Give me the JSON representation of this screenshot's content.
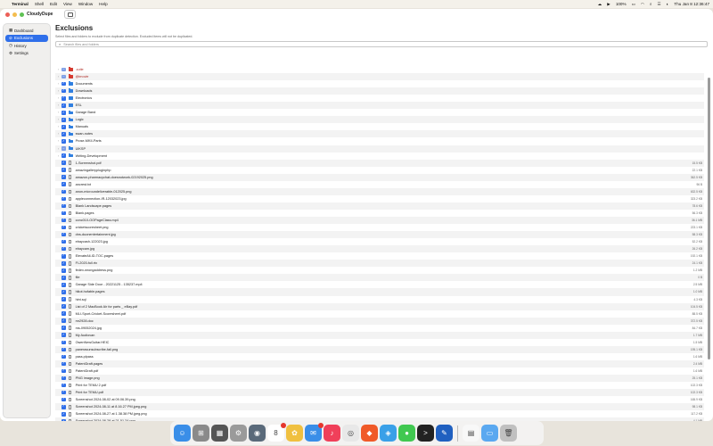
{
  "menubar": {
    "app": "Terminal",
    "menus": [
      "Shell",
      "Edit",
      "View",
      "Window",
      "Help"
    ],
    "battery": "100%",
    "datetime": "Thu Jan 8  12:36:47"
  },
  "app_title": "CloudyDupe",
  "sidebar": {
    "items": [
      {
        "label": "Dashboard",
        "icon": "dashboard-icon"
      },
      {
        "label": "Exclusions",
        "icon": "exclusions-icon"
      },
      {
        "label": "History",
        "icon": "history-icon"
      },
      {
        "label": "Settings",
        "icon": "gear-icon"
      }
    ]
  },
  "page": {
    "title": "Exclusions",
    "subtitle": "Select files and folders to exclude from duplicate detection. Excluded items will not be duplicated.",
    "search_placeholder": "Search files and folders"
  },
  "rows": [
    {
      "name": ".cutie",
      "kind": "folder-red",
      "check": "partial",
      "expand": true,
      "red": true,
      "size": ""
    },
    {
      "name": "@imovie",
      "kind": "folder-red",
      "check": "partial",
      "expand": true,
      "red": true,
      "size": ""
    },
    {
      "name": "Documents",
      "kind": "folder",
      "check": "on",
      "expand": true,
      "size": ""
    },
    {
      "name": "Downloads",
      "kind": "folder",
      "check": "on",
      "expand": true,
      "size": ""
    },
    {
      "name": "Electronics",
      "kind": "folder",
      "check": "on",
      "expand": true,
      "size": ""
    },
    {
      "name": "ESL",
      "kind": "folder",
      "check": "on",
      "expand": true,
      "size": ""
    },
    {
      "name": "Garage Band",
      "kind": "folder",
      "check": "on",
      "expand": true,
      "size": ""
    },
    {
      "name": "Logic",
      "kind": "folder",
      "check": "on",
      "expand": true,
      "size": ""
    },
    {
      "name": "Manuals",
      "kind": "folder",
      "check": "on",
      "expand": true,
      "size": ""
    },
    {
      "name": "swan-notes",
      "kind": "folder",
      "check": "on",
      "expand": true,
      "size": ""
    },
    {
      "name": "Prose-MKII-Parts",
      "kind": "folder",
      "check": "on",
      "expand": true,
      "size": ""
    },
    {
      "name": "UIKSP",
      "kind": "folder",
      "check": "partial",
      "expand": true,
      "size": ""
    },
    {
      "name": "Writing-Development",
      "kind": "folder",
      "check": "on",
      "expand": true,
      "size": ""
    },
    {
      "name": "1-Screenshot.pdf",
      "kind": "doc",
      "check": "on",
      "expand": false,
      "size": "15.5 KB"
    },
    {
      "name": "amazingallerypluginphp",
      "kind": "doc",
      "check": "on",
      "expand": false,
      "size": "22.1 KB"
    },
    {
      "name": "amazon-pharmacychat-doesnotwork-02192025.png",
      "kind": "doc",
      "check": "on",
      "expand": false,
      "size": "362.5 KB"
    },
    {
      "name": "ancrest.txt",
      "kind": "doc",
      "check": "on",
      "expand": false,
      "size": "96 B"
    },
    {
      "name": "anon-microundeliverable-012025.png",
      "kind": "doc",
      "check": "on",
      "expand": false,
      "size": "632.5 KB"
    },
    {
      "name": "appleconnection-IR-12032023.jpg",
      "kind": "doc",
      "check": "on",
      "expand": false,
      "size": "323.2 KB"
    },
    {
      "name": "Blank Landscape.pages",
      "kind": "doc",
      "check": "on",
      "expand": false,
      "size": "78.6 KB"
    },
    {
      "name": "Blank.pages",
      "kind": "doc",
      "check": "on",
      "expand": false,
      "size": "56.3 KB"
    },
    {
      "name": "conc010-OOPageClass.mp4",
      "kind": "doc",
      "check": "on",
      "expand": false,
      "size": "36.1 MB"
    },
    {
      "name": "cricketscoresheet.png",
      "kind": "doc",
      "check": "on",
      "expand": false,
      "size": "223.1 KB"
    },
    {
      "name": "dns-duonentertainment.jpg",
      "kind": "doc",
      "check": "on",
      "expand": false,
      "size": "58.3 KB"
    },
    {
      "name": "ebaycash-122023.jpg",
      "kind": "doc",
      "check": "on",
      "expand": false,
      "size": "52.2 KB"
    },
    {
      "name": "ebaycam.jpg",
      "kind": "doc",
      "check": "on",
      "expand": false,
      "size": "26.2 KB"
    },
    {
      "name": "ElevateAll-ID-TOC.pages",
      "kind": "doc",
      "check": "on",
      "expand": false,
      "size": "192.1 KB"
    },
    {
      "name": "FI-2020-full.rtx",
      "kind": "doc",
      "check": "on",
      "expand": false,
      "size": "24.1 KB"
    },
    {
      "name": "fedex-wrongaddress.png",
      "kind": "doc",
      "check": "on",
      "expand": false,
      "size": "1.2 MB"
    },
    {
      "name": "file",
      "kind": "doc",
      "check": "on",
      "expand": false,
      "size": "0 B"
    },
    {
      "name": "Garage Side Door - 20221125 - 135237.mp4",
      "kind": "doc",
      "check": "on",
      "expand": false,
      "size": "2.5 MB"
    },
    {
      "name": "hikot.hofable.pages",
      "kind": "doc",
      "check": "on",
      "expand": false,
      "size": "1.0 MB"
    },
    {
      "name": "hint.sql",
      "kind": "doc",
      "check": "on",
      "expand": false,
      "size": "4.3 KB"
    },
    {
      "name": "List of 2 MacBook Air for parts _ eBay.pdf",
      "kind": "doc",
      "check": "on",
      "expand": false,
      "size": "104.5 KB"
    },
    {
      "name": "MLI-Sport-Cricket-Scoresheet.pdf",
      "kind": "doc",
      "check": "on",
      "expand": false,
      "size": "88.5 KB"
    },
    {
      "name": "mr2928.doc",
      "kind": "doc",
      "check": "on",
      "expand": false,
      "size": "372.5 KB"
    },
    {
      "name": "ms-09052024.jpg",
      "kind": "doc",
      "check": "on",
      "expand": false,
      "size": "84.7 KB"
    },
    {
      "name": "My Audiovan",
      "kind": "doc",
      "check": "on",
      "expand": false,
      "size": "1.7 MB"
    },
    {
      "name": "OwenNewGuitar.HEIC",
      "kind": "doc",
      "check": "on",
      "expand": false,
      "size": "1.5 MB"
    },
    {
      "name": "panerasunsubscribe-fail.png",
      "kind": "doc",
      "check": "on",
      "expand": false,
      "size": "195.1 KB"
    },
    {
      "name": "pass.plpass",
      "kind": "doc",
      "check": "on",
      "expand": false,
      "size": "1.6 MB"
    },
    {
      "name": "PatentDraft.pages",
      "kind": "doc",
      "check": "on",
      "expand": false,
      "size": "2.4 MB"
    },
    {
      "name": "PatentDraft.pdf",
      "kind": "doc",
      "check": "on",
      "expand": false,
      "size": "1.6 MB"
    },
    {
      "name": "PNG image.png",
      "kind": "doc",
      "check": "on",
      "expand": false,
      "size": "25.1 KB"
    },
    {
      "name": "Print for TEMU 2.pdf",
      "kind": "doc",
      "check": "on",
      "expand": false,
      "size": "102.3 KB"
    },
    {
      "name": "Print for TEMU.pdf",
      "kind": "doc",
      "check": "on",
      "expand": false,
      "size": "102.3 KB"
    },
    {
      "name": "Screenshot 2024-08-02 at 09.06.39.png",
      "kind": "doc",
      "check": "on",
      "expand": false,
      "size": "165.9 KB"
    },
    {
      "name": "Screenshot 2024-08-11 at 8.16.27 PM.jpeg.png",
      "kind": "doc",
      "check": "on",
      "expand": false,
      "size": "98.1 KB"
    },
    {
      "name": "Screenshot 2024-08-27 at 1.38.38 PM.jpeg.png",
      "kind": "doc",
      "check": "on",
      "expand": false,
      "size": "117.2 KB"
    },
    {
      "name": "Screenshot 2024-08-28 at 21.51.24.png",
      "kind": "doc",
      "check": "on",
      "expand": false,
      "size": "4.1 MB"
    },
    {
      "name": "Screenshot 2024-09-03 at 09.13.24.png",
      "kind": "doc",
      "check": "on",
      "expand": false,
      "size": "1.4 MB"
    }
  ],
  "dock": [
    {
      "name": "finder-icon",
      "color": "#3a8ee8",
      "glyph": "☺"
    },
    {
      "name": "launchpad-icon",
      "color": "#8a8a8a",
      "glyph": "⊞"
    },
    {
      "name": "calculator-icon",
      "color": "#555555",
      "glyph": "▦"
    },
    {
      "name": "settings-icon",
      "color": "#9a9a9a",
      "glyph": "⚙"
    },
    {
      "name": "migration-icon",
      "color": "#5a6a7a",
      "glyph": "◉"
    },
    {
      "name": "calendar-icon",
      "color": "#ffffff",
      "glyph": "8"
    },
    {
      "name": "photos-icon",
      "color": "#f0c040",
      "glyph": "✿"
    },
    {
      "name": "mail-icon",
      "color": "#3a8ee8",
      "glyph": "✉"
    },
    {
      "name": "music-icon",
      "color": "#f0405a",
      "glyph": "♪"
    },
    {
      "name": "chrome-icon",
      "color": "#e8e8e8",
      "glyph": "◎"
    },
    {
      "name": "brave-icon",
      "color": "#f05a28",
      "glyph": "◆"
    },
    {
      "name": "safari-icon",
      "color": "#3aa0e8",
      "glyph": "◈"
    },
    {
      "name": "messages-icon",
      "color": "#40c850",
      "glyph": "●"
    },
    {
      "name": "terminal-icon",
      "color": "#222222",
      "glyph": ">"
    },
    {
      "name": "xcode-icon",
      "color": "#2060c0",
      "glyph": "✎"
    },
    {
      "name": "document-icon",
      "color": "#f8f8f8",
      "glyph": "▤"
    },
    {
      "name": "folder-icon",
      "color": "#5aa8f0",
      "glyph": "▭"
    },
    {
      "name": "trash-icon",
      "color": "#c0c0c0",
      "glyph": "🗑"
    }
  ],
  "colors": {
    "accent": "#2f6fea",
    "folder": "#2f7fe0",
    "red_folder": "#d63a2f"
  }
}
